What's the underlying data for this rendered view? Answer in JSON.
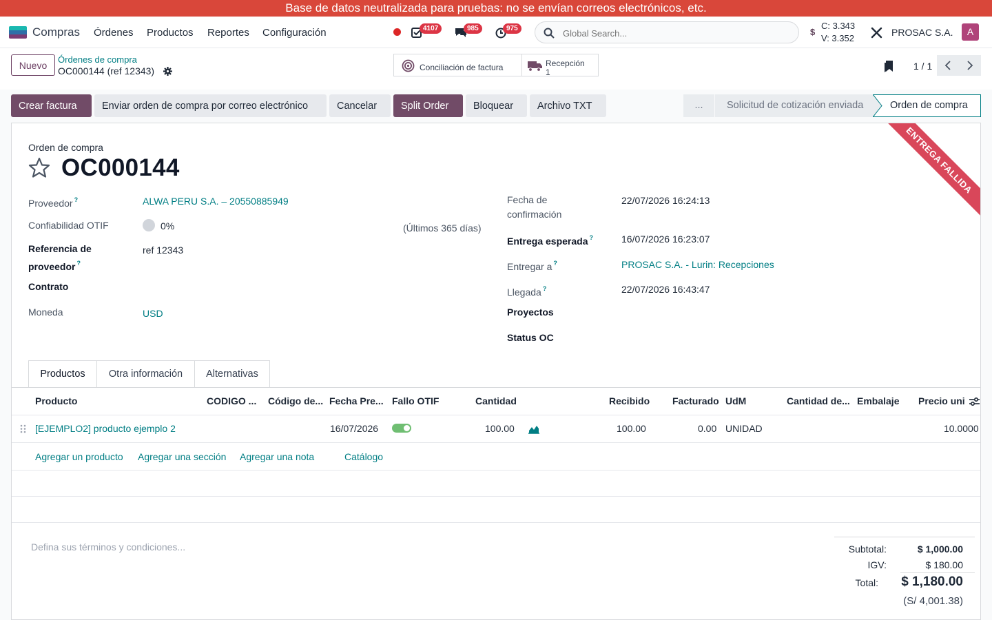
{
  "banner": "Base de datos neutralizada para pruebas: no se envían correos electrónicos, etc.",
  "navbar": {
    "app_name": "Compras",
    "menu": [
      "Órdenes",
      "Productos",
      "Reportes",
      "Configuración"
    ],
    "badges": {
      "activities": "4107",
      "messages": "985",
      "timesheets": "975"
    },
    "search_placeholder": "Global Search...",
    "rates": {
      "symbol": "$",
      "buy": "C: 3.343",
      "sell": "V: 3.352"
    },
    "company": "PROSAC S.A.",
    "avatar": "A"
  },
  "control_panel": {
    "new_button": "Nuevo",
    "breadcrumb_parent": "Órdenes de compra",
    "breadcrumb_current": "OC000144 (ref 12343)",
    "smart_buttons": {
      "invoice_reconcile": "Conciliación de factura",
      "reception_label": "Recepción",
      "reception_count": "1"
    },
    "pager": "1 / 1"
  },
  "actions": {
    "create_invoice": "Crear factura",
    "send_email": "Enviar orden de compra por correo electrónico",
    "cancel": "Cancelar",
    "split": "Split Order",
    "lock": "Bloquear",
    "txt": "Archivo TXT"
  },
  "statusbar": {
    "more": "...",
    "rfq_sent": "Solicitud de cotización enviada",
    "purchase_order": "Orden de compra"
  },
  "form": {
    "ribbon": "ENTREGA FALLIDA",
    "doc_type": "Orden de compra",
    "name": "OC000144",
    "left": {
      "vendor_label": "Proveedor",
      "vendor_value": "ALWA PERU S.A. – 20550885949",
      "otif_label": "Confiabilidad OTIF",
      "otif_value": "0%",
      "otif_period": "(Últimos 365 días)",
      "vendor_ref_label_1": "Referencia de",
      "vendor_ref_label_2": "proveedor",
      "vendor_ref_value": "ref 12343",
      "contract_label": "Contrato",
      "currency_label": "Moneda",
      "currency_value": "USD"
    },
    "right": {
      "confirm_label_1": "Fecha de",
      "confirm_label_2": "confirmación",
      "confirm_value": "22/07/2026 16:24:13",
      "expected_label": "Entrega esperada",
      "expected_value": "16/07/2026 16:23:07",
      "deliver_label": "Entregar a",
      "deliver_value": "PROSAC S.A. - Lurin: Recepciones",
      "arrival_label": "Llegada",
      "arrival_value": "22/07/2026 16:43:47",
      "projects_label": "Proyectos",
      "status_label": "Status OC"
    }
  },
  "tabs": [
    "Productos",
    "Otra información",
    "Alternativas"
  ],
  "table": {
    "headers": [
      "Producto",
      "CODIGO ...",
      "Código de...",
      "Fecha Pre...",
      "Fallo OTIF",
      "Cantidad",
      "Recibido",
      "Facturado",
      "UdM",
      "Cantidad de...",
      "Embalaje",
      "Precio unit"
    ],
    "row": {
      "product": "[EJEMPLO2] producto ejemplo 2",
      "date": "16/07/2026",
      "otif_fail": true,
      "qty": "100.00",
      "received": "100.00",
      "invoiced": "0.00",
      "uom": "UNIDAD",
      "price": "10.0000"
    },
    "add_product": "Agregar un producto",
    "add_section": "Agregar una sección",
    "add_note": "Agregar una nota",
    "catalog": "Catálogo"
  },
  "terms_placeholder": "Defina sus términos y condiciones...",
  "totals": {
    "subtotal_label": "Subtotal:",
    "subtotal_value": "$ 1,000.00",
    "tax_label": "IGV:",
    "tax_value": "$ 180.00",
    "total_label": "Total:",
    "total_value": "$ 1,180.00",
    "total_pen": "(S/ 4,001.38)"
  },
  "colors": {
    "primary": "#714b67",
    "link": "#017e84",
    "banner": "#d9473a",
    "ribbon": "#d9475a"
  }
}
